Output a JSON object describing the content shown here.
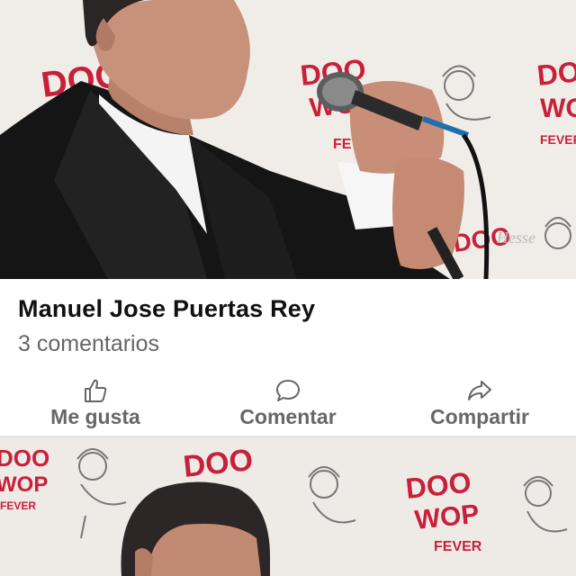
{
  "post": {
    "author": "Manuel Jose Puertas Rey",
    "comments": "3 comentarios"
  },
  "actions": {
    "like": {
      "label": "Me gusta",
      "icon": "thumbs-up-icon"
    },
    "comment": {
      "label": "Comentar",
      "icon": "speech-bubble-icon"
    },
    "share": {
      "label": "Compartir",
      "icon": "share-arrow-icon"
    }
  },
  "backdrop": {
    "logo_line1": "DOO",
    "logo_line2": "WOP",
    "logo_line3": "FEVER"
  },
  "colors": {
    "logo_red": "#c8203a",
    "jacket": "#151515",
    "text_dark": "#111111",
    "text_muted": "#65676b",
    "divider": "#e4e6eb"
  }
}
